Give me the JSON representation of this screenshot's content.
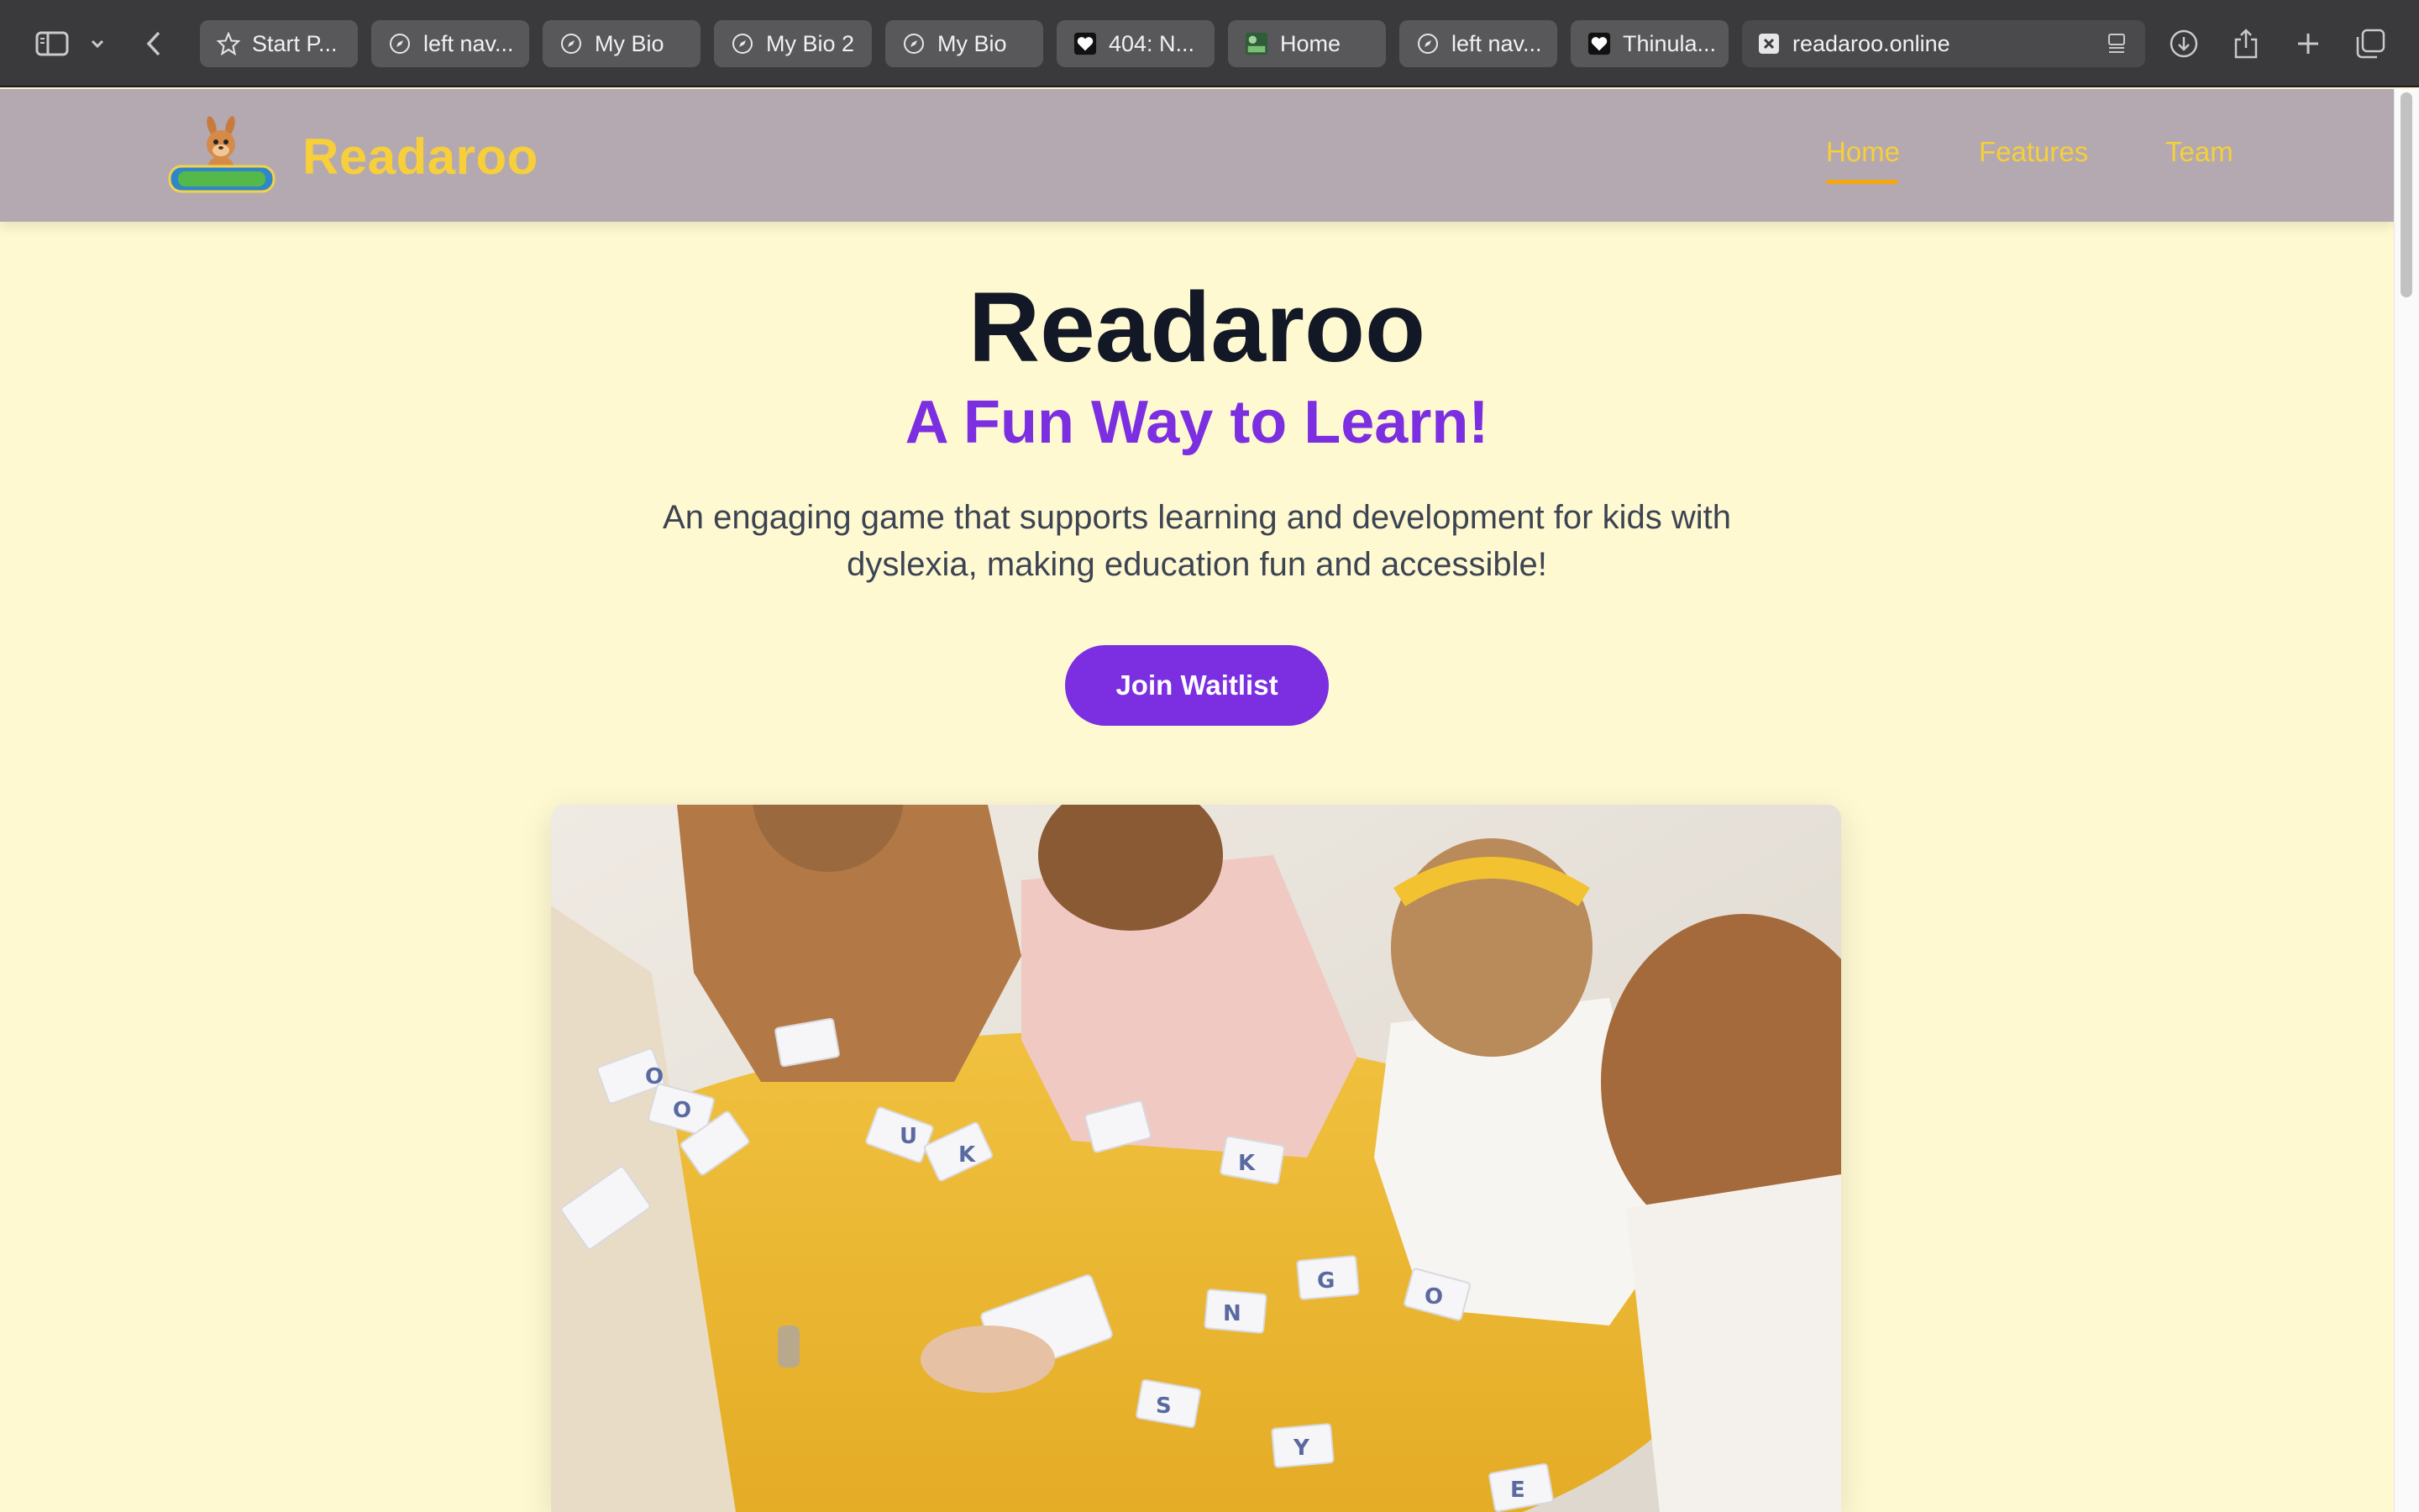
{
  "browser": {
    "tabs": [
      {
        "label": "Start P...",
        "icon": "star-icon"
      },
      {
        "label": "left nav...",
        "icon": "compass-icon"
      },
      {
        "label": "My Bio",
        "icon": "compass-icon"
      },
      {
        "label": "My Bio 2",
        "icon": "compass-icon"
      },
      {
        "label": "My Bio",
        "icon": "compass-icon"
      },
      {
        "label": "404: N...",
        "icon": "heart-favicon-icon"
      },
      {
        "label": "Home",
        "icon": "site-favicon-icon"
      },
      {
        "label": "left nav...",
        "icon": "compass-icon"
      },
      {
        "label": "Thinula...",
        "icon": "heart-favicon-icon"
      }
    ],
    "active_tab": {
      "label": "readaroo.online",
      "icon": "close-icon"
    }
  },
  "site": {
    "brand_name": "Readaroo",
    "nav": {
      "home": "Home",
      "features": "Features",
      "team": "Team"
    },
    "active_nav": "Home"
  },
  "hero": {
    "title": "Readaroo",
    "subtitle": "A Fun Way to Learn!",
    "description": "An engaging game that supports learning and development for kids with dyslexia, making education fun and accessible!",
    "cta_label": "Join Waitlist"
  },
  "colors": {
    "page_bg": "#fff9d2",
    "header_bg": "#b4a9b0",
    "brand_yellow": "#f6cf3a",
    "accent_purple": "#7b2fe0",
    "title_dark": "#121826"
  }
}
